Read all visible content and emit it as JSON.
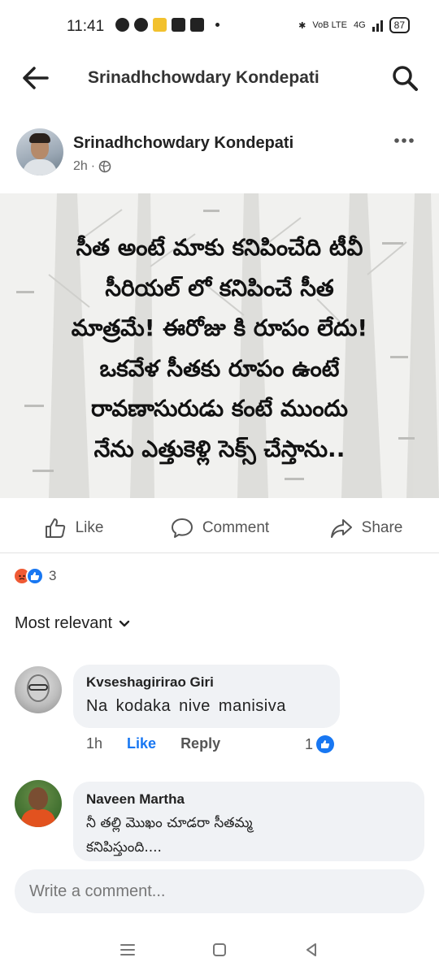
{
  "status_bar": {
    "time": "11:41",
    "network_label": "VoB LTE",
    "signal_label": "4G",
    "battery": "87"
  },
  "header": {
    "title": "Srinadhchowdary Kondepati",
    "back_icon": "back-arrow-icon",
    "search_icon": "search-icon"
  },
  "post": {
    "author": "Srinadhchowdary Kondepati",
    "time": "2h",
    "privacy_icon": "globe-icon",
    "image_text": "సీత అంటే మాకు కనిపించేది టీవీ\nసీరియల్ లో కనిపించే సీత\nమాత్రమే! ఈరోజు కి రూపం లేదు!\nఒకవేళ సీతకు రూపం ఉంటే\nరావణాసురుడు కంటే ముందు\nనేను ఎత్తుకెళ్లి సెక్స్ చేస్తాను..",
    "actions": {
      "like": "Like",
      "comment": "Comment",
      "share": "Share"
    },
    "reaction_count": "3"
  },
  "comments_section": {
    "sort_label": "Most relevant",
    "comments": [
      {
        "author": "Kvseshagirirao Giri",
        "text": "Na kodaka nive manisiva",
        "time": "1h",
        "like_label": "Like",
        "reply_label": "Reply",
        "like_count": "1"
      },
      {
        "author": "Naveen Martha",
        "text": "నీ తల్లి మొఖం చూడరా సీతమ్మ\nకనిపిస్తుంది...."
      }
    ]
  },
  "composer": {
    "placeholder": "Write a comment..."
  },
  "colors": {
    "brand_blue": "#1877f2",
    "angry_orange": "#ef5a34",
    "bubble_bg": "#f0f2f5"
  }
}
